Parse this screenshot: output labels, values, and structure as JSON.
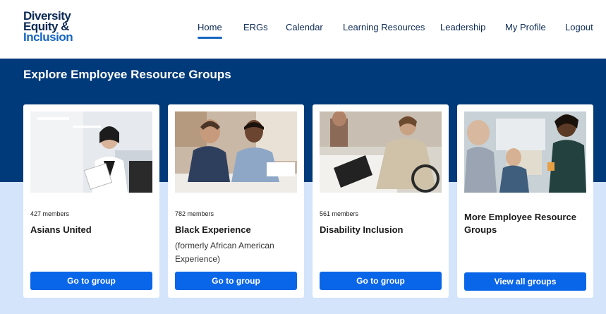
{
  "logo": {
    "line1": "Diversity",
    "line2": "Equity &",
    "line3": "Inclusion"
  },
  "nav": {
    "items": [
      {
        "label": "Home",
        "active": true
      },
      {
        "label": "ERGs"
      },
      {
        "label": "Calendar"
      },
      {
        "label": "Learning Resources"
      },
      {
        "label": "Leadership"
      },
      {
        "label": "My Profile"
      },
      {
        "label": "Logout"
      }
    ]
  },
  "section": {
    "title": "Explore Employee Resource Groups"
  },
  "cards": [
    {
      "members": "427 members",
      "title": "Asians United",
      "button": "Go to group"
    },
    {
      "members": "782 members",
      "title": "Black Experience",
      "subtitle": "(formerly African American Experience)",
      "button": "Go to group"
    },
    {
      "members": "561 members",
      "title": "Disability Inclusion",
      "button": "Go to group"
    },
    {
      "title": "More Employee Resource Groups",
      "button": "View all groups"
    }
  ],
  "colors": {
    "navy": "#003a7a",
    "light_blue": "#d3e4fb",
    "button": "#0a66e8",
    "logo": "#0b2a55"
  }
}
